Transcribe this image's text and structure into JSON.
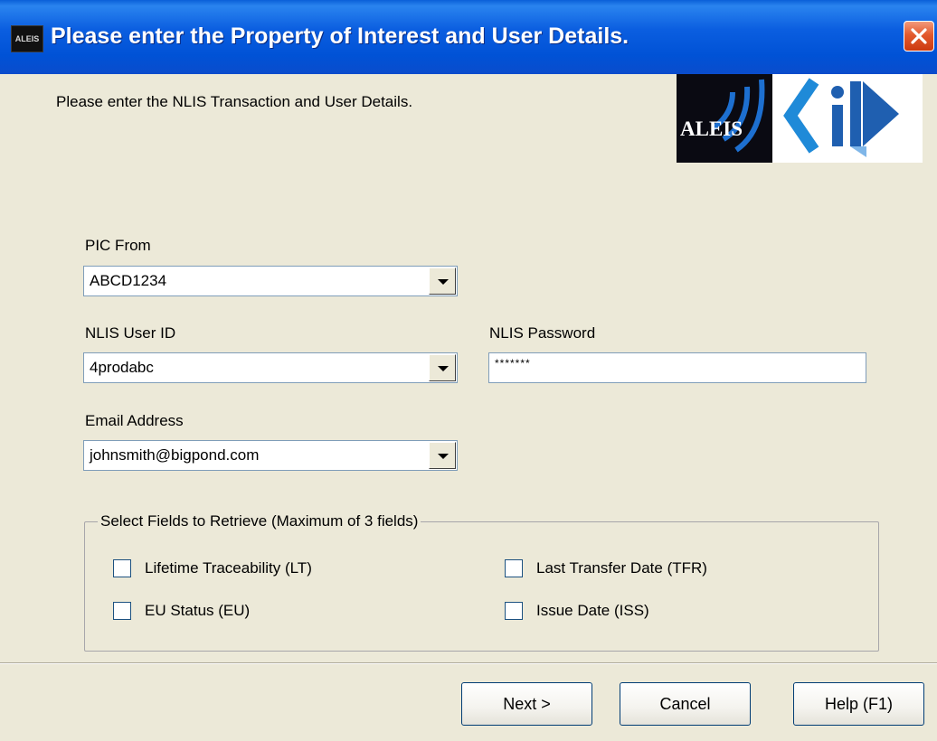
{
  "window": {
    "title": "Please enter the Property of Interest and User Details.",
    "icon_text": "ALEIS",
    "close_icon": "close-x",
    "accent_color": "#0a5fd8"
  },
  "header": {
    "instruction": "Please enter the NLIS Transaction and User Details.",
    "logo_text": "ALEIS",
    "logo_secondary": "iD-logo"
  },
  "form": {
    "pic_from": {
      "label": "PIC From",
      "value": "ABCD1234"
    },
    "user_id": {
      "label": "NLIS User ID",
      "value": "4prodabc"
    },
    "password": {
      "label": "NLIS Password",
      "value": "*******"
    },
    "email": {
      "label": "Email Address",
      "value": "johnsmith@bigpond.com"
    }
  },
  "fields_group": {
    "title": "Select Fields to Retrieve (Maximum of 3 fields)",
    "options": [
      {
        "label": "Lifetime Traceability (LT)",
        "checked": false
      },
      {
        "label": "Last Transfer Date (TFR)",
        "checked": false
      },
      {
        "label": "EU Status (EU)",
        "checked": false
      },
      {
        "label": "Issue Date (ISS)",
        "checked": false
      }
    ]
  },
  "buttons": {
    "next": "Next >",
    "cancel": "Cancel",
    "help": "Help (F1)"
  }
}
